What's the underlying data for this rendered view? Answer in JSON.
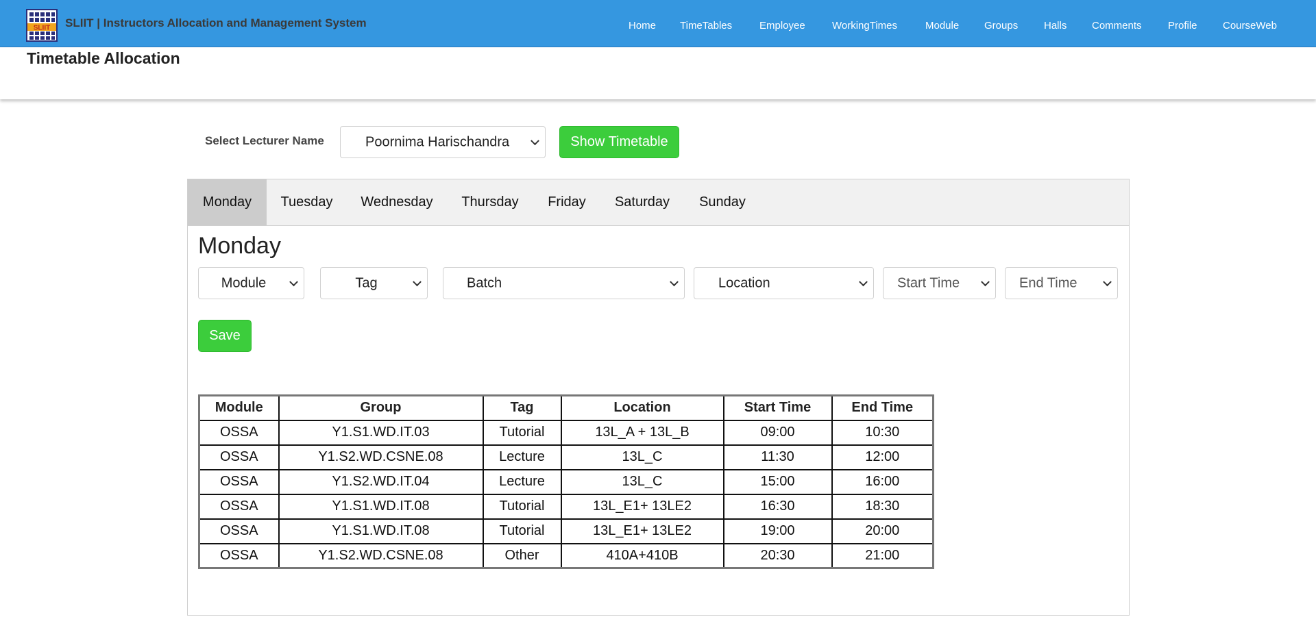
{
  "navbar": {
    "brand": "SLIIT | Instructors Allocation and Management System",
    "logo_text": "SLIIT",
    "links": [
      "Home",
      "TimeTables",
      "Employee",
      "WorkingTimes",
      "Module",
      "Groups",
      "Halls",
      "Comments",
      "Profile",
      "CourseWeb"
    ]
  },
  "page": {
    "title": "Timetable Allocation"
  },
  "lecturer": {
    "label": "Select Lecturer Name",
    "selected": "Poornima Harischandra",
    "show_button": "Show Timetable"
  },
  "tabs": [
    "Monday",
    "Tuesday",
    "Wednesday",
    "Thursday",
    "Friday",
    "Saturday",
    "Sunday"
  ],
  "active_tab": "Monday",
  "form": {
    "heading": "Monday",
    "selects": [
      "Module",
      "Tag",
      "Batch",
      "Location",
      "Start Time",
      "End Time"
    ],
    "save_button": "Save"
  },
  "table": {
    "headers": [
      "Module",
      "Group",
      "Tag",
      "Location",
      "Start Time",
      "End Time"
    ],
    "rows": [
      [
        "OSSA",
        "Y1.S1.WD.IT.03",
        "Tutorial",
        "13L_A + 13L_B",
        "09:00",
        "10:30"
      ],
      [
        "OSSA",
        "Y1.S2.WD.CSNE.08",
        "Lecture",
        "13L_C",
        "11:30",
        "12:00"
      ],
      [
        "OSSA",
        "Y1.S2.WD.IT.04",
        "Lecture",
        "13L_C",
        "15:00",
        "16:00"
      ],
      [
        "OSSA",
        "Y1.S1.WD.IT.08",
        "Tutorial",
        "13L_E1+ 13LE2",
        "16:30",
        "18:30"
      ],
      [
        "OSSA",
        "Y1.S1.WD.IT.08",
        "Tutorial",
        "13L_E1+ 13LE2",
        "19:00",
        "20:00"
      ],
      [
        "OSSA",
        "Y1.S2.WD.CSNE.08",
        "Other",
        "410A+410B",
        "20:30",
        "21:00"
      ]
    ]
  },
  "colors": {
    "navbar": "#3597e0",
    "button_green": "#3ccd3c",
    "active_tab": "#cccccc",
    "tabbar": "#f1f1f1"
  }
}
